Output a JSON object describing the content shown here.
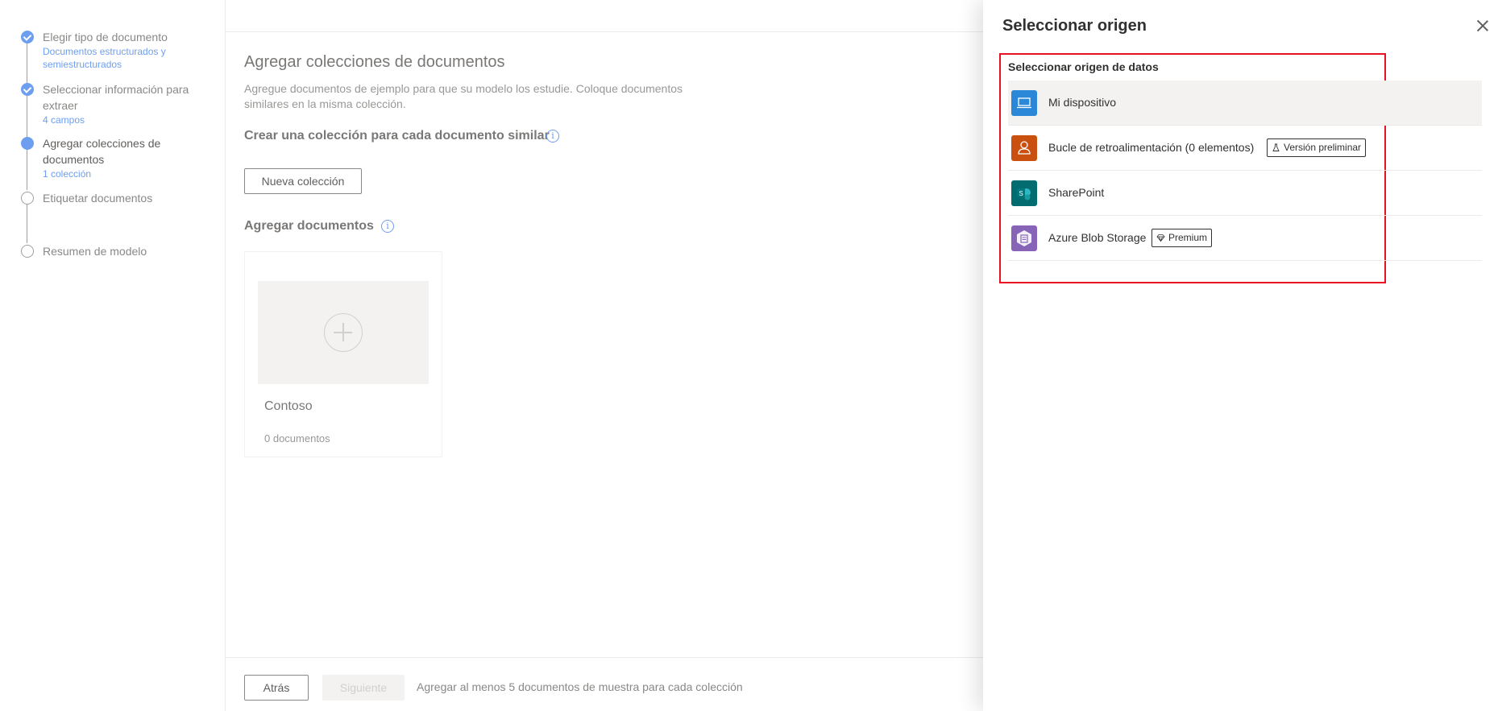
{
  "wizard": {
    "steps": [
      {
        "title": "Elegir tipo de documento",
        "sub": "Documentos estructurados y semiestructurados",
        "state": "done"
      },
      {
        "title": "Seleccionar información para extraer",
        "sub": "4 campos",
        "state": "done"
      },
      {
        "title": "Agregar colecciones de documentos",
        "sub": "1 colección",
        "state": "current"
      },
      {
        "title": "Etiquetar documentos",
        "sub": "",
        "state": "todo"
      },
      {
        "title": "Resumen de modelo",
        "sub": "",
        "state": "todo"
      }
    ]
  },
  "main": {
    "title": "Agregar colecciones de documentos",
    "description": "Agregue documentos de ejemplo para que su modelo los estudie. Coloque documentos similares en la misma colección.",
    "collection_heading": "Crear una colección para cada documento similar",
    "new_collection_label": "Nueva colección",
    "documents_heading": "Agregar documentos",
    "card": {
      "name": "Contoso",
      "count": "0 documentos"
    }
  },
  "footer": {
    "back_label": "Atrás",
    "next_label": "Siguiente",
    "hint": "Agregar al menos 5 documentos de muestra para cada colección"
  },
  "panel": {
    "title": "Seleccionar origen",
    "subtitle": "Seleccionar origen de datos",
    "sources": [
      {
        "label": "Mi dispositivo",
        "icon": "laptop-icon",
        "color": "#2b88d8",
        "selected": true
      },
      {
        "label": "Bucle de retroalimentación (0 elementos)",
        "icon": "person-icon",
        "color": "#ca5010",
        "badge": "Versión preliminar",
        "badge_icon": "flask-icon"
      },
      {
        "label": "SharePoint",
        "icon": "sharepoint-icon",
        "color": "#036c70"
      },
      {
        "label": "Azure Blob Storage",
        "icon": "blob-storage-icon",
        "color": "#8764b8",
        "badge": "Premium",
        "badge_icon": "diamond-icon"
      }
    ]
  },
  "colors": {
    "accent": "#6e9ef0",
    "highlight": "#e81123"
  }
}
